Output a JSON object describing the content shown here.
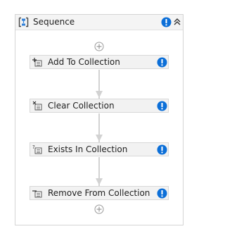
{
  "sequence": {
    "title": "Sequence",
    "activities": [
      {
        "label": "Add To Collection"
      },
      {
        "label": "Clear Collection"
      },
      {
        "label": "Exists In Collection"
      },
      {
        "label": "Remove From Collection"
      }
    ]
  },
  "colors": {
    "warning": "#0c6fd8",
    "connector": "#d2d2d2",
    "border": "#d4d4d4"
  },
  "icons": {
    "sequence": "sequence-icon",
    "warning": "info-warning-icon",
    "collapse": "double-chevron-up-icon",
    "add": "plus-circle-icon",
    "activity": "collection-activity-icon"
  }
}
